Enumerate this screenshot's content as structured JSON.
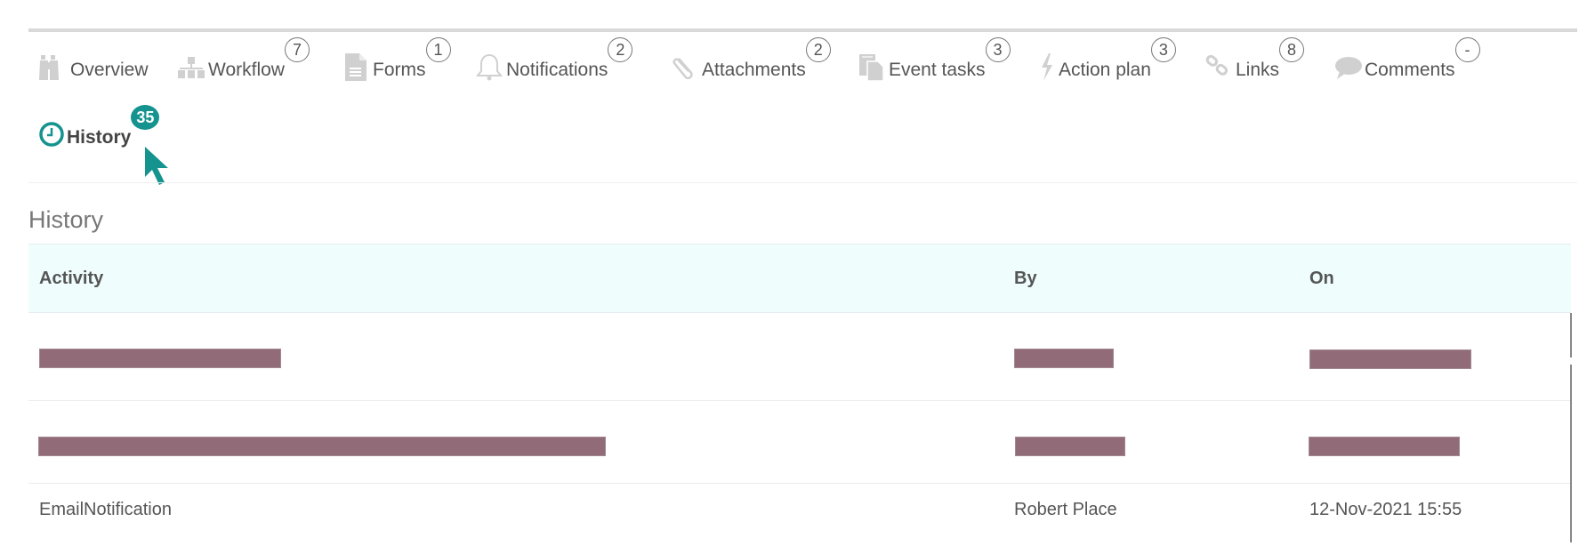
{
  "tabs": [
    {
      "label": "Overview",
      "icon": "binoculars-icon",
      "badge": null
    },
    {
      "label": "Workflow",
      "icon": "org-chart-icon",
      "badge": "7"
    },
    {
      "label": "Forms",
      "icon": "document-icon",
      "badge": "1"
    },
    {
      "label": "Notifications",
      "icon": "bell-icon",
      "badge": "2"
    },
    {
      "label": "Attachments",
      "icon": "paperclip-icon",
      "badge": "2"
    },
    {
      "label": "Event tasks",
      "icon": "copy-document-icon",
      "badge": "3"
    },
    {
      "label": "Action plan",
      "icon": "lightning-icon",
      "badge": "3"
    },
    {
      "label": "Links",
      "icon": "link-icon",
      "badge": "8"
    },
    {
      "label": "Comments",
      "icon": "speech-bubble-icon",
      "badge": "-"
    },
    {
      "label": "History",
      "icon": "clock-icon",
      "badge": "35",
      "active": true
    }
  ],
  "colors": {
    "accent": "#14938f",
    "icon_inactive": "#d0d0d0",
    "header_bg": "#effdfd",
    "redaction": "#916c78"
  },
  "section": {
    "title": "History"
  },
  "table": {
    "columns": [
      "Activity",
      "By",
      "On"
    ],
    "rows": [
      {
        "activity": "[redacted]",
        "by": "[redacted]",
        "on": "[redacted]",
        "redacted": true
      },
      {
        "activity": "[redacted]",
        "by": "[redacted]",
        "on": "[redacted]",
        "redacted": true
      },
      {
        "activity": "EmailNotification",
        "by": "Robert Place",
        "on": "12-Nov-2021 15:55",
        "redacted": false
      }
    ]
  }
}
